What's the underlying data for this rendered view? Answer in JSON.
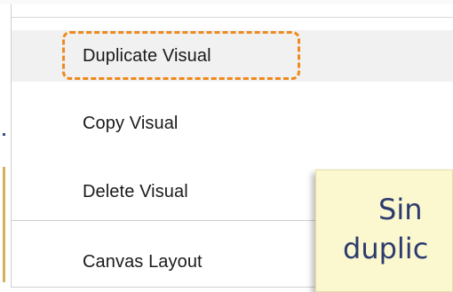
{
  "context_menu": {
    "items": [
      {
        "label": "Duplicate Visual",
        "highlighted": true
      },
      {
        "label": "Copy Visual"
      },
      {
        "label": "Delete Visual"
      },
      {
        "label": "Canvas Layout"
      }
    ]
  },
  "tooltip": {
    "line1": "Sin",
    "line2": "duplic"
  },
  "colors": {
    "focus_border": "#ef8a1c",
    "tooltip_bg": "#fbf7cf",
    "tooltip_text": "#2c3b6e",
    "highlight_bg": "#f1f1f1"
  }
}
